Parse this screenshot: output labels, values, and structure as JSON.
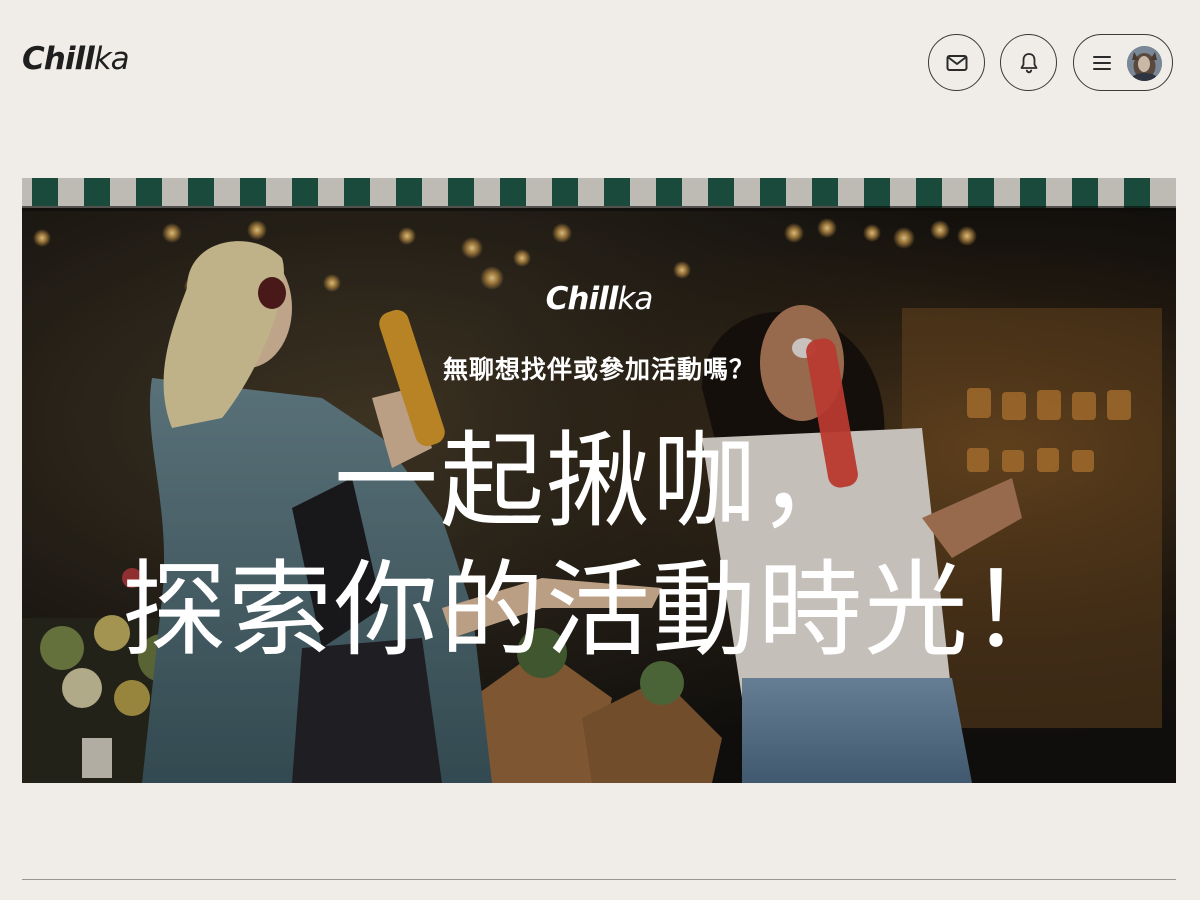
{
  "header": {
    "logo_main": "Chill",
    "logo_tail": "ka",
    "icons": {
      "mail": "mail-icon",
      "bell": "bell-icon",
      "menu": "hamburger-menu-icon",
      "avatar": "user-avatar"
    }
  },
  "hero": {
    "logo_main": "Chill",
    "logo_tail": "ka",
    "subtitle": "無聊想找伴或參加活動嗎？",
    "title_line_1": "一起揪咖，",
    "title_line_2": "探索你的活動時光！"
  },
  "colors": {
    "page_background": "#f0ede8",
    "text_dark": "#1f1f1f",
    "hero_text": "#ffffff",
    "awning_green": "#1f5b4a",
    "awning_white": "#e8e4dc"
  }
}
